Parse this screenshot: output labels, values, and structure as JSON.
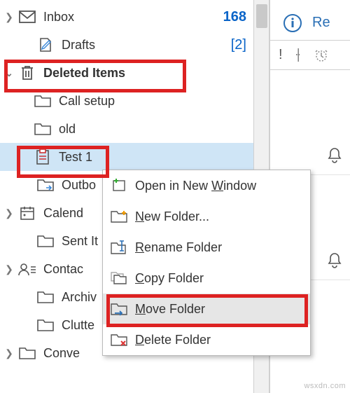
{
  "nav": {
    "inbox": {
      "label": "Inbox",
      "badge": "168"
    },
    "drafts": {
      "label": "Drafts",
      "badge": "[2]"
    },
    "deleted": {
      "label": "Deleted Items"
    },
    "call_setup": {
      "label": "Call setup"
    },
    "old": {
      "label": "old"
    },
    "test1": {
      "label": "Test 1"
    },
    "outbox": {
      "label": "Outbo"
    },
    "calendar": {
      "label": "Calend"
    },
    "sent": {
      "label": "Sent It"
    },
    "contacts": {
      "label": "Contac"
    },
    "archive": {
      "label": "Archiv"
    },
    "clutter": {
      "label": "Clutte"
    },
    "conversation": {
      "label": "Conve"
    }
  },
  "reading": {
    "info_label": "Re",
    "flag": "!",
    "reminder": "⏰"
  },
  "ctx": {
    "open": {
      "pre": "Open in New ",
      "u": "W",
      "post": "indow"
    },
    "new": {
      "pre": "",
      "u": "N",
      "post": "ew Folder..."
    },
    "rename": {
      "pre": "",
      "u": "R",
      "post": "ename Folder"
    },
    "copy": {
      "pre": "",
      "u": "C",
      "post": "opy Folder"
    },
    "move": {
      "pre": "",
      "u": "M",
      "post": "ove Folder"
    },
    "delete": {
      "pre": "",
      "u": "D",
      "post": "elete Folder"
    }
  },
  "watermark": "wsxdn.com"
}
